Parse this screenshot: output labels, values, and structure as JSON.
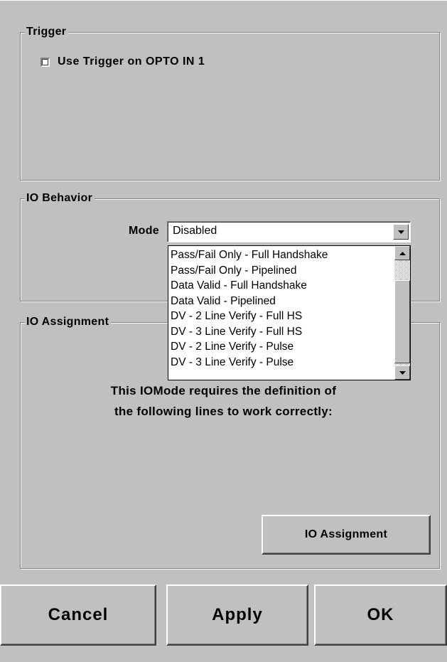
{
  "trigger": {
    "title": "Trigger",
    "checkbox_label": "Use Trigger on OPTO IN 1",
    "checked": false
  },
  "io_behavior": {
    "title": "IO Behavior",
    "mode_label": "Mode",
    "mode_value": "Disabled",
    "options": [
      "Pass/Fail Only - Full Handshake",
      "Pass/Fail Only - Pipelined",
      "Data Valid - Full Handshake",
      "Data Valid - Pipelined",
      "DV - 2 Line Verify - Full HS",
      "DV - 3 Line Verify - Full HS",
      "DV - 2 Line Verify - Pulse",
      "DV - 3 Line Verify - Pulse"
    ]
  },
  "io_assignment": {
    "title": "IO Assignment",
    "message_line1": "This IOMode requires the definition of",
    "message_line2": "the following lines to work correctly:",
    "button_label": "IO Assignment"
  },
  "footer": {
    "cancel": "Cancel",
    "apply": "Apply",
    "ok": "OK"
  },
  "icons": {
    "checkbox": "checkbox-unchecked",
    "combo_arrow": "chevron-down-icon",
    "scroll_up": "arrow-up-icon",
    "scroll_down": "arrow-down-icon"
  }
}
